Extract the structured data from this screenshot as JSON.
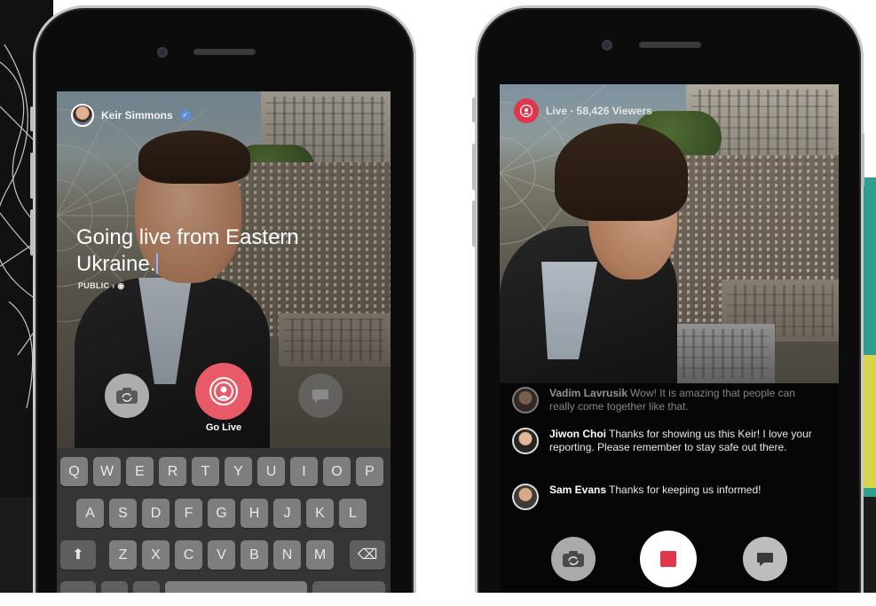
{
  "left_phone": {
    "author_name": "Keir Simmons",
    "status_text": "Going live from Eastern Ukraine.",
    "privacy_label": "PUBLIC",
    "go_live_label": "Go Live",
    "keyboard": {
      "row1": [
        "Q",
        "W",
        "E",
        "R",
        "T",
        "Y",
        "U",
        "I",
        "O",
        "P"
      ],
      "row2": [
        "A",
        "S",
        "D",
        "F",
        "G",
        "H",
        "J",
        "K",
        "L"
      ],
      "row3": [
        "Z",
        "X",
        "C",
        "V",
        "B",
        "N",
        "M"
      ]
    }
  },
  "right_phone": {
    "live_status": "Live · 58,426 Viewers",
    "comments": [
      {
        "name": "Vadim Lavrusik",
        "text": "Wow! It is amazing that people can really come together like that."
      },
      {
        "name": "Jiwon Choi",
        "text": "Thanks for showing us this Keir! I love your reporting. Please remember to stay safe out there."
      },
      {
        "name": "Sam Evans",
        "text": "Thanks for keeping us informed!"
      }
    ]
  },
  "colors": {
    "live_red": "#e0384a",
    "go_live_pink": "#e85a67",
    "verified_blue": "#5b8fd8"
  }
}
